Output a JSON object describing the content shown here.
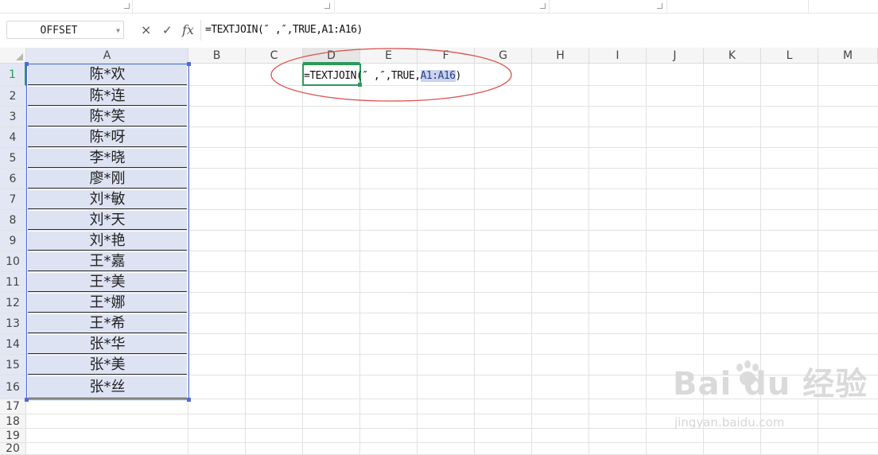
{
  "name_box": {
    "value": "OFFSET"
  },
  "formula_bar": {
    "cancel_icon": "×",
    "enter_icon": "✓",
    "fx_label": "fx",
    "formula": "=TEXTJOIN(″ ,″,TRUE,A1:A16)"
  },
  "columns": [
    "A",
    "B",
    "C",
    "D",
    "E",
    "F",
    "G",
    "H",
    "I",
    "J",
    "K",
    "L",
    "M"
  ],
  "rows": [
    "1",
    "2",
    "3",
    "4",
    "5",
    "6",
    "7",
    "8",
    "9",
    "10",
    "11",
    "12",
    "13",
    "14",
    "15",
    "16",
    "17",
    "18",
    "19",
    "20"
  ],
  "column_a_values": [
    "陈*欢",
    "陈*连",
    "陈*笑",
    "陈*呀",
    "李*晓",
    "廖*刚",
    "刘*敏",
    "刘*天",
    "刘*艳",
    "王*嘉",
    "王*美",
    "王*娜",
    "王*希",
    "张*华",
    "张*美",
    "张*丝"
  ],
  "active_cell": {
    "address": "D1",
    "formula_prefix": "=TEXTJOIN(″ ,″,TRUE,",
    "range_ref": "A1:A16",
    "formula_suffix": ")"
  },
  "annotation": {
    "shape": "ellipse",
    "color": "#d9534f"
  },
  "watermark": {
    "main": "Bai du 经验",
    "sub": "jingyan.baidu.com"
  },
  "colors": {
    "selection_fill": "#dde3f3",
    "selection_border": "#4a6ed8",
    "active_border": "#2b9a5c"
  }
}
